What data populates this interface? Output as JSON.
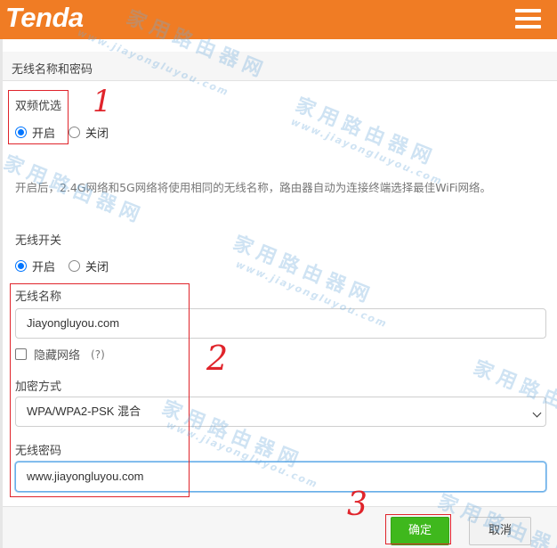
{
  "brand": {
    "logo_text": "Tenda",
    "accent_color": "#f07c24"
  },
  "header": {
    "menu_icon": "hamburger-menu-icon"
  },
  "section": {
    "title": "无线名称和密码"
  },
  "dual_band": {
    "label": "双频优选",
    "options": [
      {
        "label": "开启",
        "checked": true
      },
      {
        "label": "关闭",
        "checked": false
      }
    ],
    "description": "开启后，2.4G网络和5G网络将使用相同的无线名称，路由器自动为连接终端选择最佳WiFi网络。"
  },
  "wireless_switch": {
    "label": "无线开关",
    "options": [
      {
        "label": "开启",
        "checked": true
      },
      {
        "label": "关闭",
        "checked": false
      }
    ]
  },
  "ssid": {
    "label": "无线名称",
    "value": "Jiayongluyou.com"
  },
  "hide_network": {
    "label": "隐藏网络",
    "help": "(?)",
    "checked": false
  },
  "encryption": {
    "label": "加密方式",
    "selected": "WPA/WPA2-PSK 混合"
  },
  "password": {
    "label": "无线密码",
    "value": "www.jiayongluyou.com"
  },
  "footer": {
    "ok_label": "确定",
    "cancel_label": "取消",
    "ok_color": "#3fb81d"
  },
  "annotations": {
    "mark1": "1",
    "mark2": "2",
    "mark3": "3",
    "color": "#e0242b"
  },
  "watermark": {
    "text": "家用路由器网",
    "url": "www.jiayongluyou.com"
  }
}
